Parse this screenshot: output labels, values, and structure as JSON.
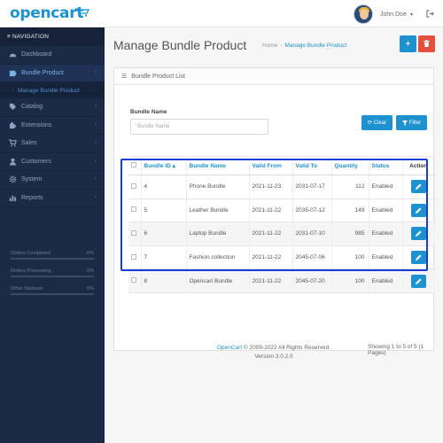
{
  "header": {
    "logo": "opencart",
    "user_name": "John Doe",
    "caret": "▾"
  },
  "sidebar": {
    "heading": "≡ NAVIGATION",
    "items": [
      {
        "label": "Dashboard",
        "icon": "dashboard-icon",
        "arrow": false
      },
      {
        "label": "Bundle Product",
        "icon": "puzzle-icon",
        "arrow": true
      },
      {
        "label": "Catalog",
        "icon": "tag-icon",
        "arrow": true
      },
      {
        "label": "Extensions",
        "icon": "puzzle-piece-icon",
        "arrow": true
      },
      {
        "label": "Sales",
        "icon": "cart-icon",
        "arrow": true
      },
      {
        "label": "Customers",
        "icon": "user-icon",
        "arrow": true
      },
      {
        "label": "System",
        "icon": "cog-icon",
        "arrow": true
      },
      {
        "label": "Reports",
        "icon": "bar-chart-icon",
        "arrow": true
      }
    ],
    "sub_item": "Manage Bundle Product",
    "stats": [
      {
        "label": "Orders Completed",
        "value": "0%"
      },
      {
        "label": "Orders Processing",
        "value": "0%"
      },
      {
        "label": "Other Statuses",
        "value": "0%"
      }
    ]
  },
  "page": {
    "title": "Manage Bundle Product",
    "breadcrumb_home": "Home",
    "breadcrumb_sep": "›",
    "breadcrumb_current": "Manage Bundle Product",
    "add_label": "+",
    "panel_title": "Bundle Product List"
  },
  "filter": {
    "label": "Bundle Name",
    "placeholder": "Bundle Name",
    "clear_label": "Clear",
    "filter_label": "Filter"
  },
  "table": {
    "headers": {
      "id": "Bundle ID",
      "sort": "▴",
      "name": "Bundle Name",
      "valid_from": "Valid From",
      "valid_to": "Valid To",
      "quantity": "Quantity",
      "status": "Status",
      "action": "Action"
    },
    "rows": [
      {
        "id": "4",
        "name": "Phone Bundle",
        "from": "2021-11-23",
        "to": "2031-07-17",
        "qty": "112",
        "status": "Enabled"
      },
      {
        "id": "5",
        "name": "Leather Bundle",
        "from": "2021-11-22",
        "to": "2035-07-12",
        "qty": "149",
        "status": "Enabled"
      },
      {
        "id": "6",
        "name": "Laptop Bundle",
        "from": "2021-11-22",
        "to": "2031-07-10",
        "qty": "985",
        "status": "Enabled"
      },
      {
        "id": "7",
        "name": "Fashion collection",
        "from": "2021-11-22",
        "to": "2045-07-06",
        "qty": "100",
        "status": "Enabled"
      },
      {
        "id": "8",
        "name": "Opencart Bundle",
        "from": "2021-11-22",
        "to": "2045-07-20",
        "qty": "100",
        "status": "Enabled"
      }
    ]
  },
  "pager": {
    "info": "Showing 1 to 5 of 5 (1 Pages)"
  },
  "footer": {
    "brand": "OpenCart",
    "copyright": " © 2009-2022 All Rights Reserved.",
    "version": "Version 3.0.2.0"
  },
  "colors": {
    "accent": "#1e91cf",
    "danger": "#e3503e",
    "sidebar_bg": "#1b2a45",
    "highlight": "#1a3bd6"
  }
}
